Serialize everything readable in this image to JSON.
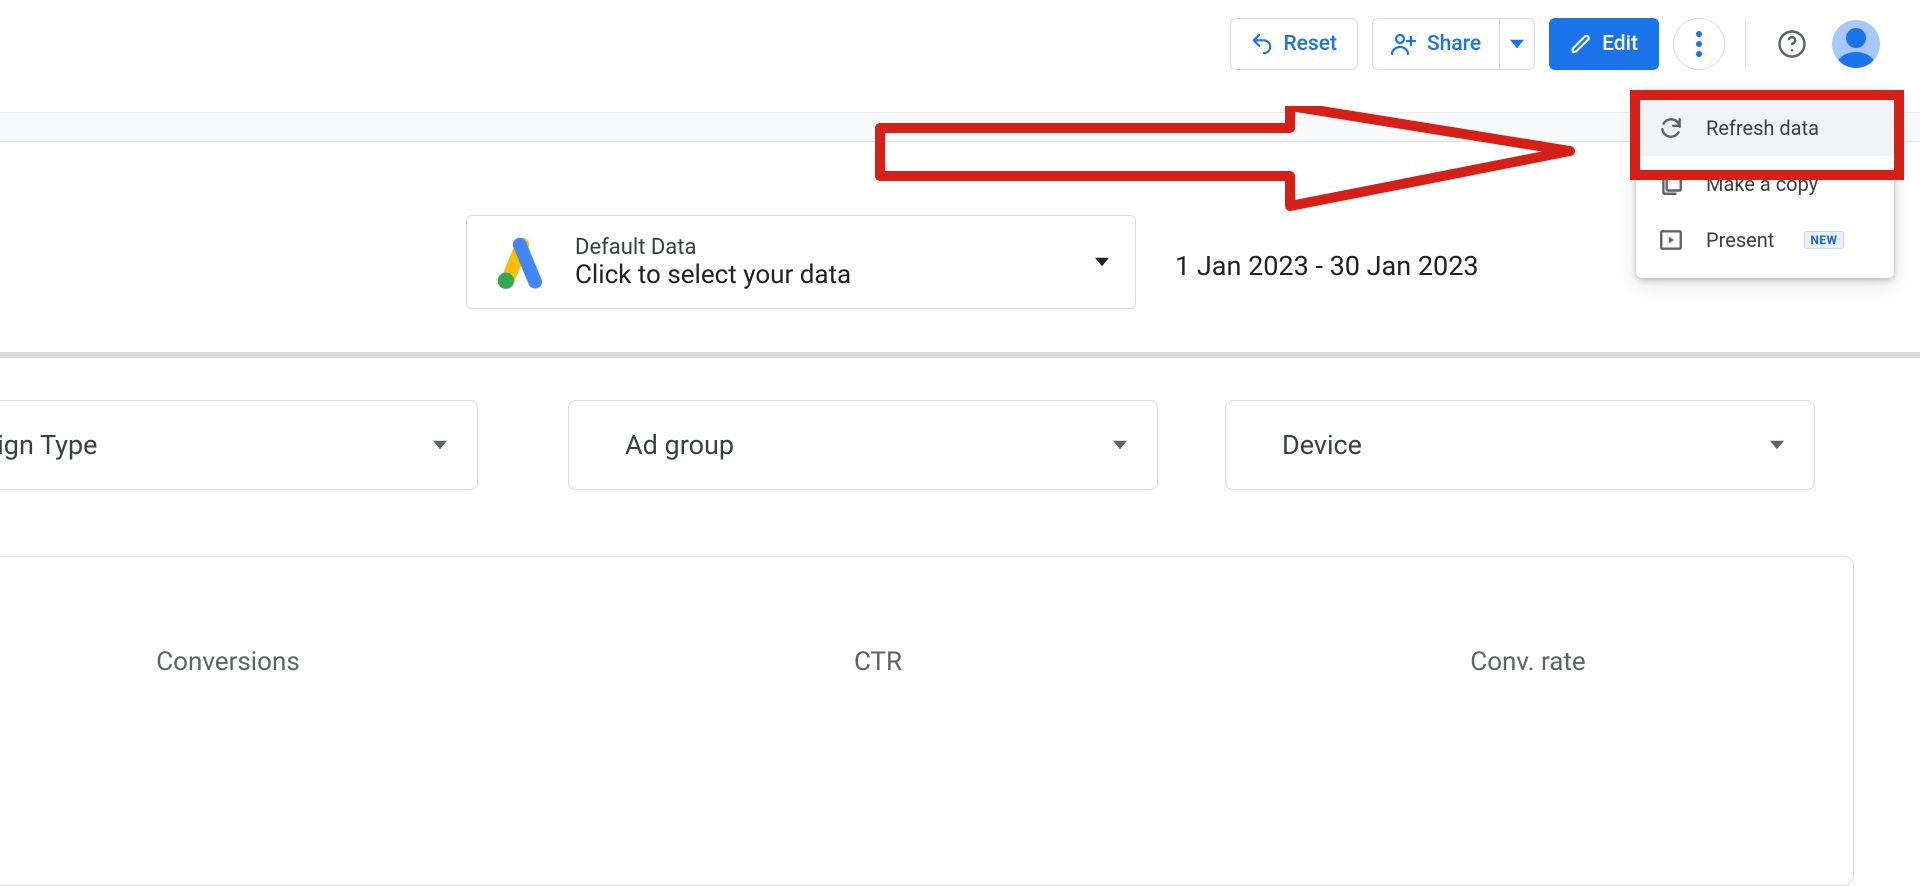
{
  "toolbar": {
    "reset": "Reset",
    "share": "Share",
    "edit": "Edit"
  },
  "menu": {
    "refresh": "Refresh data",
    "make_copy": "Make a copy",
    "present": "Present",
    "present_badge": "NEW"
  },
  "datasource": {
    "title": "Default Data",
    "subtitle": "Click to select your data"
  },
  "daterange": "1 Jan 2023 - 30 Jan 2023",
  "filters": {
    "campaign_type": "ampaign Type",
    "ad_group": "Ad group",
    "device": "Device"
  },
  "scorecards": {
    "conversions": "Conversions",
    "ctr": "CTR",
    "conv_rate": "Conv. rate"
  }
}
